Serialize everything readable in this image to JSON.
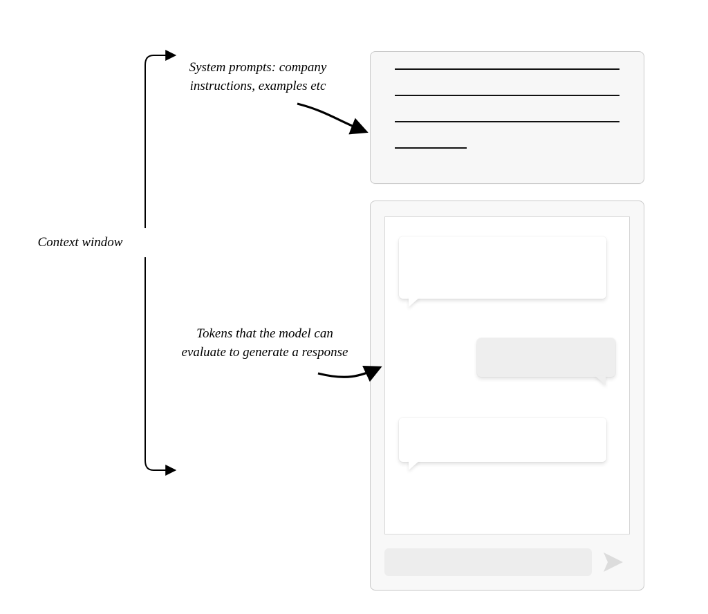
{
  "labels": {
    "context_window": "Context window",
    "system_prompts": "System prompts: company instructions, examples etc",
    "tokens": "Tokens that the model can evaluate to generate a response"
  },
  "system_panel": {
    "line_count": 4,
    "line_styles": [
      "long",
      "long",
      "long",
      "short"
    ]
  },
  "chat": {
    "bubbles": [
      {
        "side": "left"
      },
      {
        "side": "right"
      },
      {
        "side": "left"
      }
    ],
    "input_placeholder": "",
    "send_icon": "send-icon"
  }
}
